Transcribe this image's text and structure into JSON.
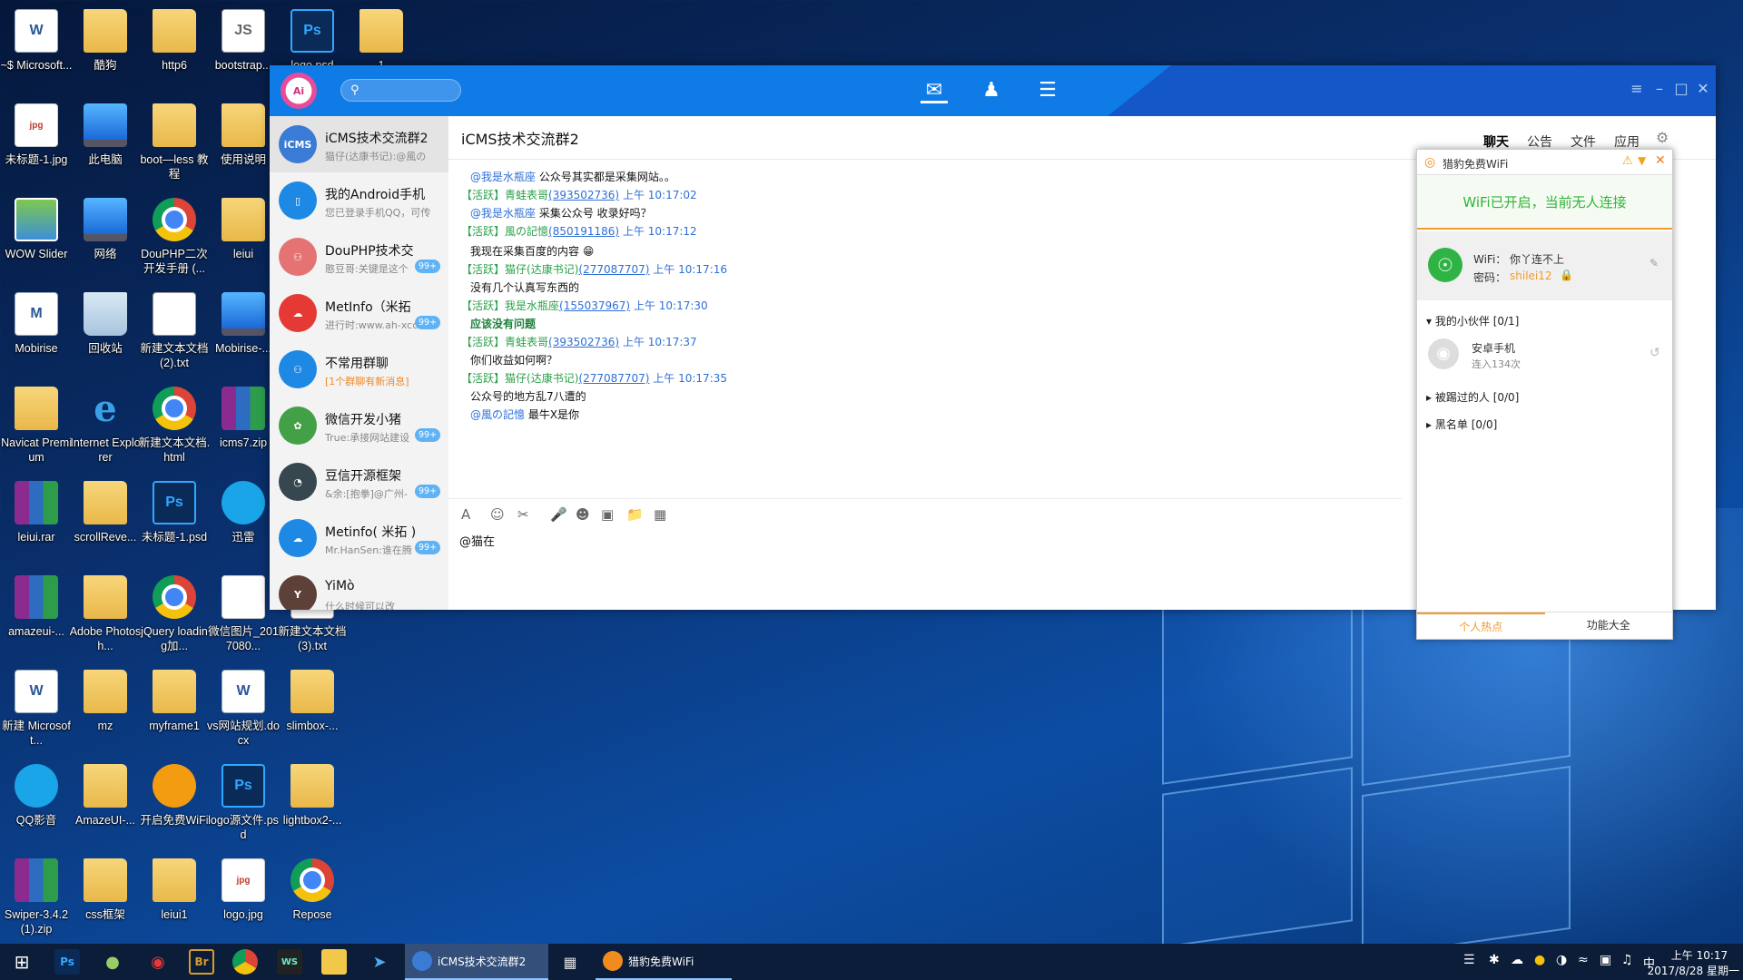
{
  "desktop": {
    "icons": [
      {
        "label": "~$ Microsoft...",
        "type": "doc",
        "glyph": "W"
      },
      {
        "label": "酷狗",
        "type": "folder",
        "glyph": ""
      },
      {
        "label": "http6",
        "type": "folder",
        "glyph": ""
      },
      {
        "label": "bootstrap...",
        "type": "txt",
        "glyph": "JS"
      },
      {
        "label": "logo.psd",
        "type": "psd",
        "glyph": "Ps"
      },
      {
        "label": "1",
        "type": "folder",
        "glyph": ""
      },
      {
        "label": "未标题-1.jpg",
        "type": "jpg",
        "glyph": "jpg"
      },
      {
        "label": "此电脑",
        "type": "pc",
        "glyph": ""
      },
      {
        "label": "boot—less 教程",
        "type": "folder",
        "glyph": ""
      },
      {
        "label": "使用说明",
        "type": "folder",
        "glyph": ""
      },
      {
        "label": "WOW Slider",
        "type": "img",
        "glyph": ""
      },
      {
        "label": "网络",
        "type": "pc",
        "glyph": ""
      },
      {
        "label": "DouPHP二次开发手册 (...",
        "type": "chrome",
        "glyph": ""
      },
      {
        "label": "leiui",
        "type": "folder",
        "glyph": ""
      },
      {
        "label": "Mobirise",
        "type": "doc",
        "glyph": "M"
      },
      {
        "label": "回收站",
        "type": "bin",
        "glyph": ""
      },
      {
        "label": "新建文本文档 (2).txt",
        "type": "txt",
        "glyph": ""
      },
      {
        "label": "Mobirise-...",
        "type": "pc",
        "glyph": ""
      },
      {
        "label": "Navicat Premium",
        "type": "folder",
        "glyph": ""
      },
      {
        "label": "Internet Explorer",
        "type": "ie",
        "glyph": "e"
      },
      {
        "label": "新建文本文档.html",
        "type": "chrome",
        "glyph": ""
      },
      {
        "label": "icms7.zip",
        "type": "rar",
        "glyph": ""
      },
      {
        "label": "leiui.rar",
        "type": "rar",
        "glyph": ""
      },
      {
        "label": "scrollReve...",
        "type": "folder",
        "glyph": ""
      },
      {
        "label": "未标题-1.psd",
        "type": "psd",
        "glyph": "Ps"
      },
      {
        "label": "迅雷",
        "type": "qq",
        "glyph": ""
      },
      {
        "label": "amazeui-...",
        "type": "rar",
        "glyph": ""
      },
      {
        "label": "Adobe Photosh...",
        "type": "folder",
        "glyph": ""
      },
      {
        "label": "jQuery loading加...",
        "type": "chrome",
        "glyph": ""
      },
      {
        "label": "微信图片_2017080...",
        "type": "jpg",
        "glyph": ""
      },
      {
        "label": "新建文本文档 (3).txt",
        "type": "txt",
        "glyph": ""
      },
      {
        "label": "新建 Microsoft...",
        "type": "doc",
        "glyph": "W"
      },
      {
        "label": "mz",
        "type": "folder",
        "glyph": ""
      },
      {
        "label": "myframe1",
        "type": "folder",
        "glyph": ""
      },
      {
        "label": "vs网站规划.docx",
        "type": "doc",
        "glyph": "W"
      },
      {
        "label": "slimbox-...",
        "type": "folder",
        "glyph": ""
      },
      {
        "label": "QQ影音",
        "type": "qq",
        "glyph": ""
      },
      {
        "label": "AmazeUI-...",
        "type": "folder",
        "glyph": ""
      },
      {
        "label": "开启免费WiFi",
        "type": "wifi",
        "glyph": ""
      },
      {
        "label": "logo源文件.psd",
        "type": "psd",
        "glyph": "Ps"
      },
      {
        "label": "lightbox2-...",
        "type": "folder",
        "glyph": ""
      },
      {
        "label": "Swiper-3.4.2 (1).zip",
        "type": "rar",
        "glyph": ""
      },
      {
        "label": "css框架",
        "type": "folder",
        "glyph": ""
      },
      {
        "label": "leiui1",
        "type": "folder",
        "glyph": ""
      },
      {
        "label": "logo.jpg",
        "type": "jpg",
        "glyph": "jpg"
      },
      {
        "label": "Repose",
        "type": "chrome",
        "glyph": ""
      }
    ]
  },
  "chat": {
    "title": "iCMS技术交流群2",
    "tabs": [
      "聊天",
      "公告",
      "文件",
      "应用"
    ],
    "contacts": [
      {
        "name": "iCMS技术交流群2",
        "msg": "猫仔(达康书记):@風の",
        "color": "#3a7bd5",
        "avatar": "iCMS",
        "badge": ""
      },
      {
        "name": "我的Android手机",
        "msg": "您已登录手机QQ，可传",
        "color": "#1e88e5",
        "avatar": "▯",
        "badge": ""
      },
      {
        "name": "DouPHP技术交",
        "msg": "憨豆哥:关键是这个",
        "color": "#e57373",
        "avatar": "⚇",
        "badge": "99+"
      },
      {
        "name": "MetInfo（米拓",
        "msg": "进行时:www.ah-xcc",
        "color": "#e53935",
        "avatar": "☁",
        "badge": "99+"
      },
      {
        "name": "不常用群聊",
        "msg": "[1个群聊有新消息]",
        "color": "#1e88e5",
        "avatar": "⚇",
        "badge": ""
      },
      {
        "name": "微信开发小猪",
        "msg": "True:承接网站建设",
        "color": "#43a047",
        "avatar": "✿",
        "badge": "99+"
      },
      {
        "name": "豆信开源框架",
        "msg": "&余:[抱拳]@广州-",
        "color": "#37474f",
        "avatar": "◔",
        "badge": "99+"
      },
      {
        "name": "Metinfo( 米拓 )",
        "msg": "Mr.HanSen:谁在腾",
        "color": "#1e88e5",
        "avatar": "☁",
        "badge": "99+"
      },
      {
        "name": "YiMò",
        "msg": "什么时候可以改",
        "color": "#5d4037",
        "avatar": "Y",
        "badge": ""
      }
    ],
    "messages": [
      {
        "kind": "text",
        "at": "@我是水瓶座",
        "text": " 公众号其实都是采集网站。。"
      },
      {
        "kind": "header",
        "tag": "【活跃】",
        "nick": "青蛙表哥",
        "qq": "(393502736)",
        "time": "上午 10:17:02"
      },
      {
        "kind": "text",
        "at": "@我是水瓶座",
        "text": " 采集公众号 收录好吗？"
      },
      {
        "kind": "header",
        "tag": "【活跃】",
        "nick": "風の記憶",
        "qq": "(850191186)",
        "time": "上午 10:17:12"
      },
      {
        "kind": "text",
        "at": "",
        "text": "我现在采集百度的内容 😁"
      },
      {
        "kind": "header",
        "tag": "【活跃】",
        "nick": "猫仔(达康书记)",
        "qq": "(277087707)",
        "time": "上午 10:17:16"
      },
      {
        "kind": "text",
        "at": "",
        "text": "没有几个认真写东西的"
      },
      {
        "kind": "header",
        "tag": "【活跃】",
        "nick": "我是水瓶座",
        "qq": "(155037967)",
        "time": "上午 10:17:30"
      },
      {
        "kind": "bold",
        "at": "",
        "text": "应该没有问题"
      },
      {
        "kind": "header",
        "tag": "【活跃】",
        "nick": "青蛙表哥",
        "qq": "(393502736)",
        "time": "上午 10:17:37"
      },
      {
        "kind": "text",
        "at": "",
        "text": "你们收益如何啊？"
      },
      {
        "kind": "header",
        "tag": "【活跃】",
        "nick": "猫仔(达康书记)",
        "qq": "(277087707)",
        "time": "上午 10:17:35"
      },
      {
        "kind": "text",
        "at": "",
        "text": "公众号的地方乱7八遭的"
      },
      {
        "kind": "text",
        "at": "@風の記憶",
        "text": " 最牛X是你"
      }
    ],
    "input_value": "@猫在"
  },
  "wifi": {
    "title": "猎豹免费WiFi",
    "status": "WiFi已开启，当前无人连接",
    "wifi_label": "WiFi：",
    "wifi_name": "你丫连不上",
    "pwd_label": "密码：",
    "pwd": "shilei12",
    "partners": "我的小伙伴",
    "partners_count": "[0/1]",
    "device_name": "安卓手机",
    "device_info": "连入134次",
    "kicked": "被踢过的人",
    "kicked_count": "[0/0]",
    "blacklist": "黑名单",
    "blacklist_count": "[0/0]",
    "tab_hot": "个人热点",
    "tab_all": "功能大全"
  },
  "taskbar": {
    "tasks": [
      {
        "label": "iCMS技术交流群2"
      },
      {
        "label": "猎豹免费WiFi"
      }
    ],
    "time": "上午 10:17",
    "date": "2017/8/28 星期一",
    "ime": "中"
  }
}
